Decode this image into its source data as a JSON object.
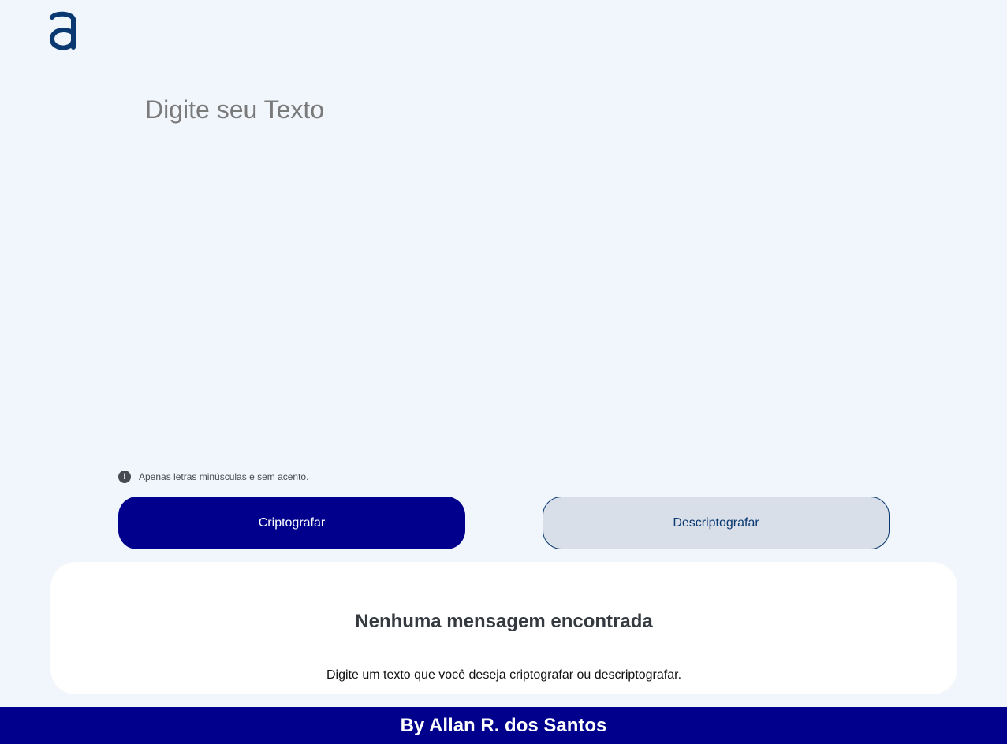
{
  "header": {
    "logo_icon": "alura-a-logo-icon",
    "logo_color": "#0a3871"
  },
  "input": {
    "placeholder": "Digite seu Texto",
    "value": ""
  },
  "hint": {
    "icon": "exclamation-circle-icon",
    "text": "Apenas letras minúsculas e sem acento."
  },
  "actions": {
    "encrypt_label": "Criptografar",
    "decrypt_label": "Descriptografar"
  },
  "output": {
    "title": "Nenhuma mensagem encontrada",
    "text": "Digite um texto que você deseja criptografar ou descriptografar."
  },
  "footer": {
    "text": "By Allan R. dos Santos"
  },
  "colors": {
    "background": "#f1f5fc",
    "primary": "#00008d",
    "secondary_bg": "#d8dfe8",
    "accent": "#0a3871"
  }
}
